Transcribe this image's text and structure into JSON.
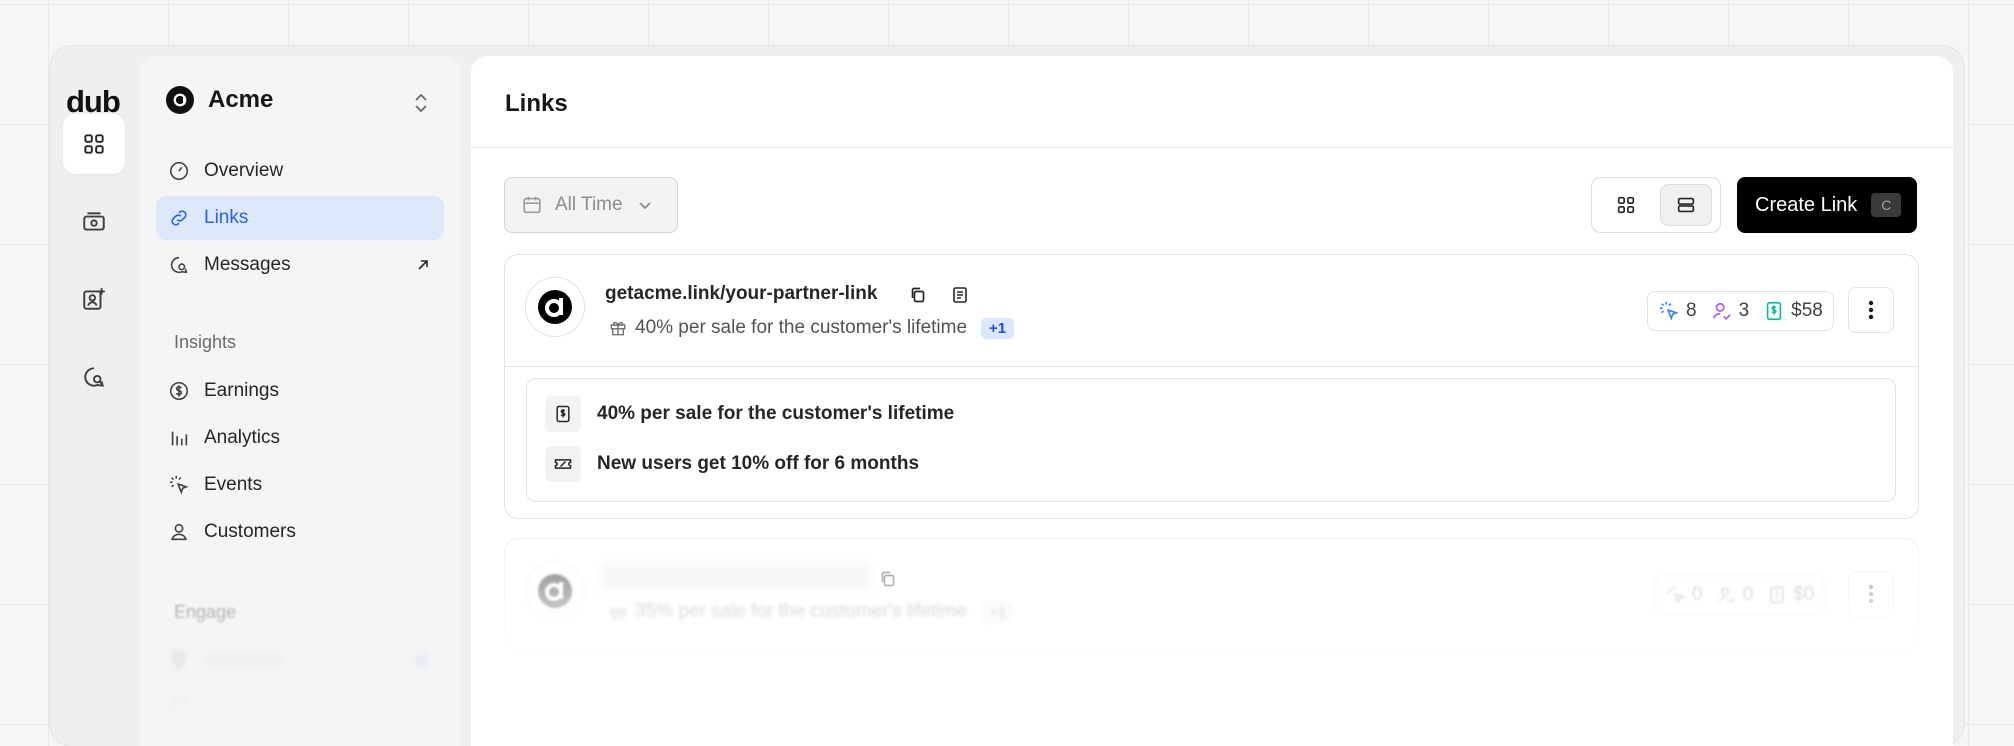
{
  "brand": {
    "logo": "dub"
  },
  "workspace": {
    "name": "Acme"
  },
  "nav": {
    "overview": "Overview",
    "links": "Links",
    "messages": "Messages",
    "insights_title": "Insights",
    "earnings": "Earnings",
    "analytics": "Analytics",
    "events": "Events",
    "customers": "Customers",
    "engage_title": "Engage"
  },
  "page": {
    "title": "Links"
  },
  "toolbar": {
    "date_filter": "All Time",
    "create_label": "Create Link",
    "create_shortcut": "C"
  },
  "links": [
    {
      "url": "getacme.link/your-partner-link",
      "reward_summary": "40% per sale for the customer's lifetime",
      "extra_badge": "+1",
      "stats": {
        "clicks": "8",
        "leads": "3",
        "sales": "$58"
      },
      "rewards": [
        {
          "icon": "receipt-dollar-icon",
          "text": "40% per sale for the customer's lifetime"
        },
        {
          "icon": "discount-ticket-icon",
          "text": "New users get 10% off for 6 months"
        }
      ]
    },
    {
      "reward_summary": "35% per sale for the customer's lifetime",
      "extra_badge": "+1",
      "stats": {
        "clicks": "0",
        "leads": "0",
        "sales": "$0"
      }
    }
  ],
  "colors": {
    "accent": "#2563eb",
    "active_bg": "#dde8fb",
    "leads": "#a855f7",
    "sales": "#14b8a6",
    "clicks": "#3b82f6"
  }
}
